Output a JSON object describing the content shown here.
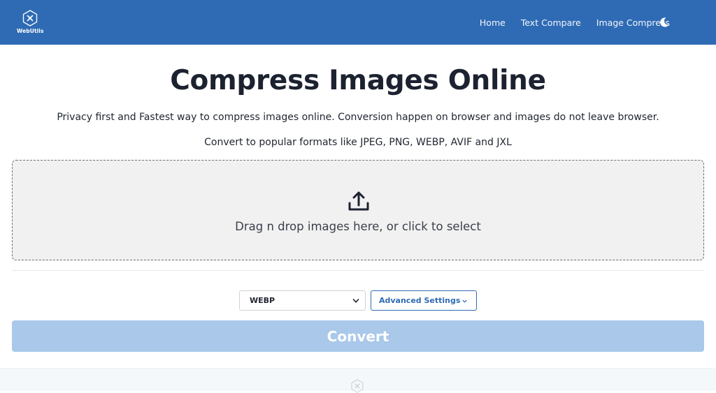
{
  "navbar": {
    "logo_text": "WebUtils",
    "links": [
      {
        "label": "Home"
      },
      {
        "label": "Text Compare"
      },
      {
        "label": "Image Compress"
      }
    ],
    "theme_toggle_icon": "moon-icon",
    "background_color": "#2f6bb4"
  },
  "hero": {
    "title": "Compress Images Online",
    "subtitle": "Privacy first and Fastest way to compress images online. Conversion happen on browser and images do not leave browser.",
    "formats_text": "Convert to popular formats like JPEG, PNG, WEBP, AVIF and JXL"
  },
  "dropzone": {
    "icon": "upload-icon",
    "text": "Drag n drop images here, or click to select"
  },
  "controls": {
    "format_select": {
      "selected": "WEBP",
      "icon": "chevron-down-icon"
    },
    "advanced_settings_label": "Advanced Settings",
    "advanced_settings_icon": "chevron-down-icon",
    "convert_label": "Convert",
    "convert_color": "#a9c8ea"
  },
  "footer": {
    "logo_icon": "webutils-logo-icon"
  }
}
